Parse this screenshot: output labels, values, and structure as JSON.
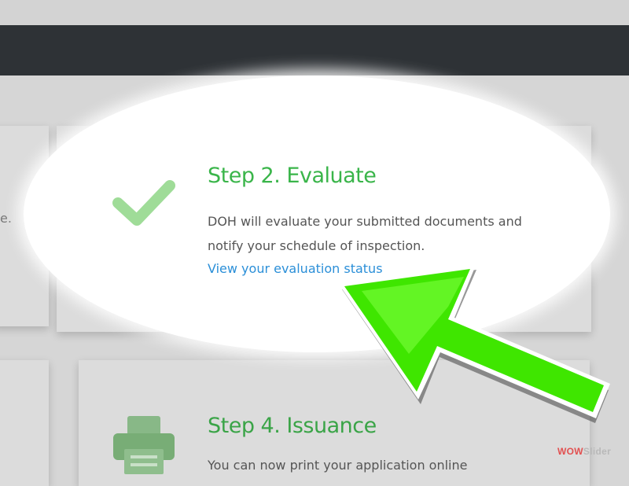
{
  "step2": {
    "title": "Step 2. Evaluate",
    "description": "DOH will evaluate your submitted documents and notify your schedule of inspection.",
    "link": "View your evaluation status",
    "icon": "checkmark-icon",
    "title_color": "#3ab54a",
    "link_color": "#2b8fd8"
  },
  "step4": {
    "title": "Step 4. Issuance",
    "description": "You can now print your application online",
    "icon": "printer-icon"
  },
  "edge_text": "e.",
  "annotation": {
    "icon": "arrow-pointer-icon",
    "color": "#44ee00"
  },
  "watermark": {
    "wow": "WOW",
    "slider": "Slider"
  },
  "colors": {
    "navbar": "#2e3236",
    "page_bg": "#d6d6d6"
  }
}
